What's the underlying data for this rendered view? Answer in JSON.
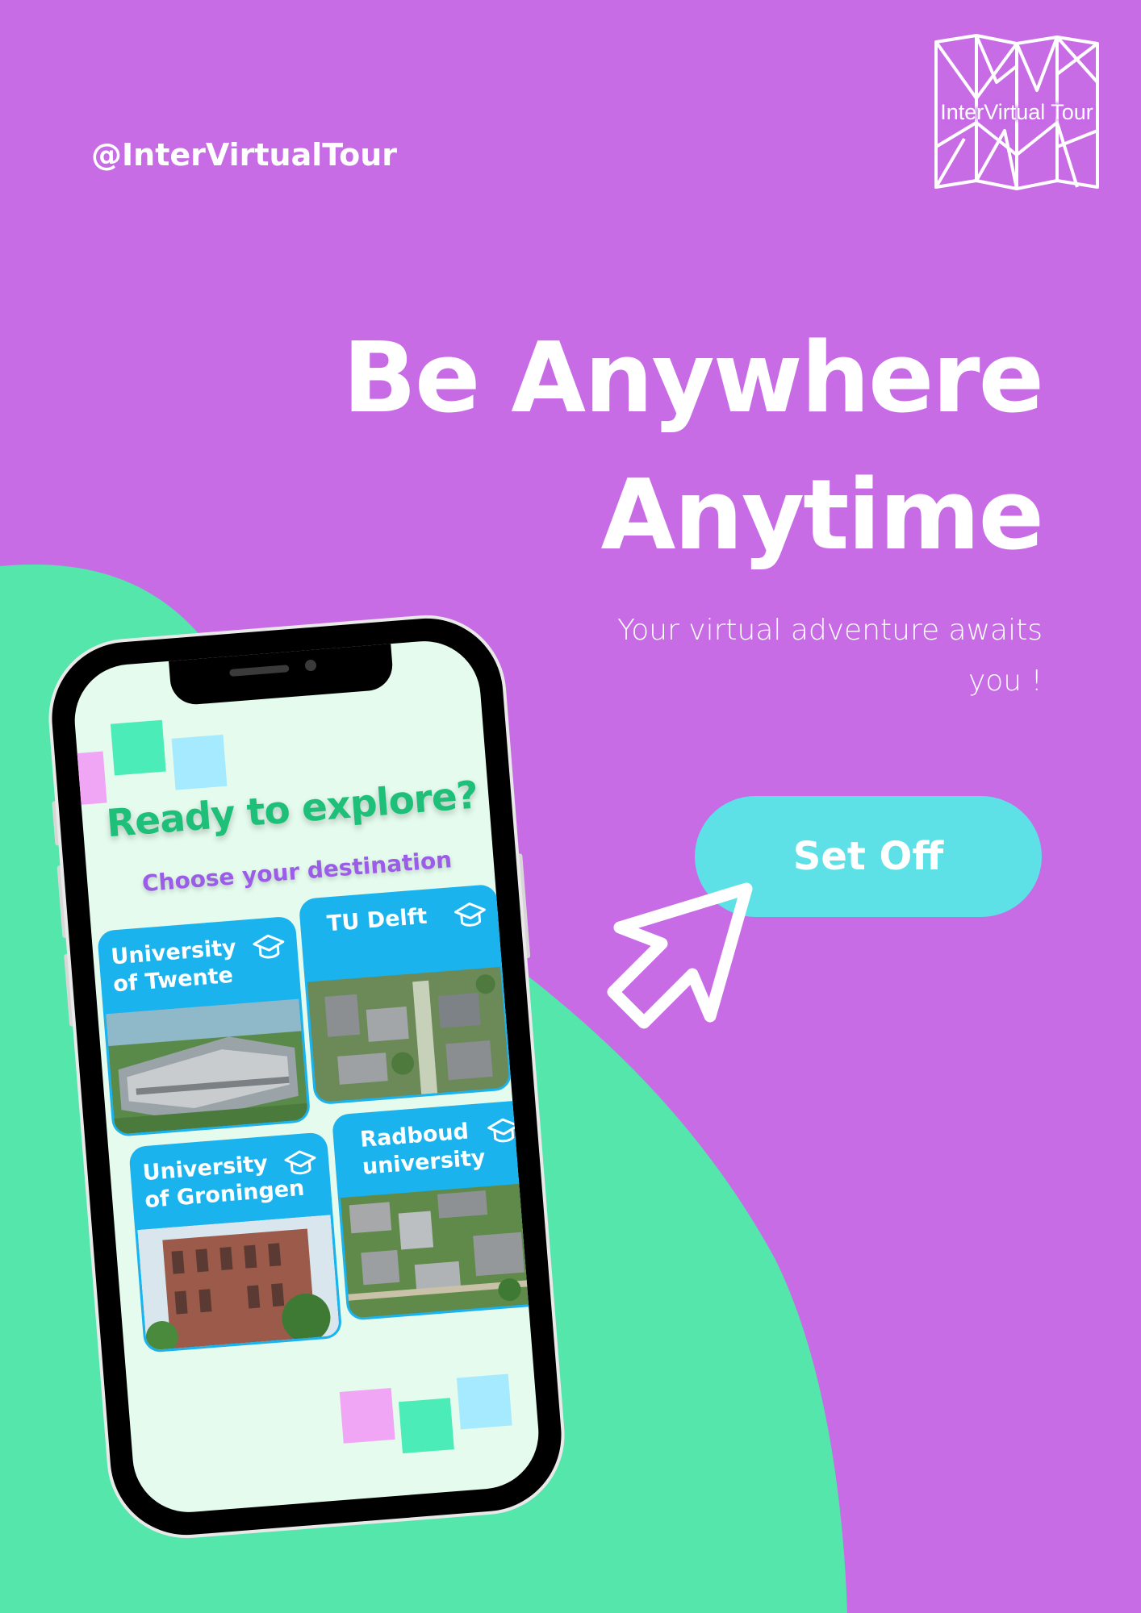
{
  "colors": {
    "background": "#c86ce6",
    "blob": "#55e6ac",
    "cta": "#5ee1e6",
    "phone_title": "#1ebf78",
    "phone_subtitle": "#9b5de8",
    "card": "#1ab3ee"
  },
  "handle": "@InterVirtualTour",
  "logo": {
    "text": "InterVirtual Tour",
    "icon": "folded-map-icon"
  },
  "headline": {
    "line1": "Be Anywhere",
    "line2": "Anytime"
  },
  "subtitle": {
    "line1": "Your virtual adventure awaits",
    "line2": "you !"
  },
  "cta": {
    "label": "Set Off",
    "icon": "pointer-arrow-icon"
  },
  "phone": {
    "title": "Ready to explore?",
    "subtitle": "Choose your destination",
    "destinations": [
      {
        "line1": "University",
        "line2": "of Twente",
        "icon": "graduation-cap-icon"
      },
      {
        "line1": "TU Delft",
        "line2": "",
        "icon": "graduation-cap-icon"
      },
      {
        "line1": "University",
        "line2": "of Groningen",
        "icon": "graduation-cap-icon"
      },
      {
        "line1": "Radboud",
        "line2": "university",
        "icon": "graduation-cap-icon"
      }
    ]
  }
}
